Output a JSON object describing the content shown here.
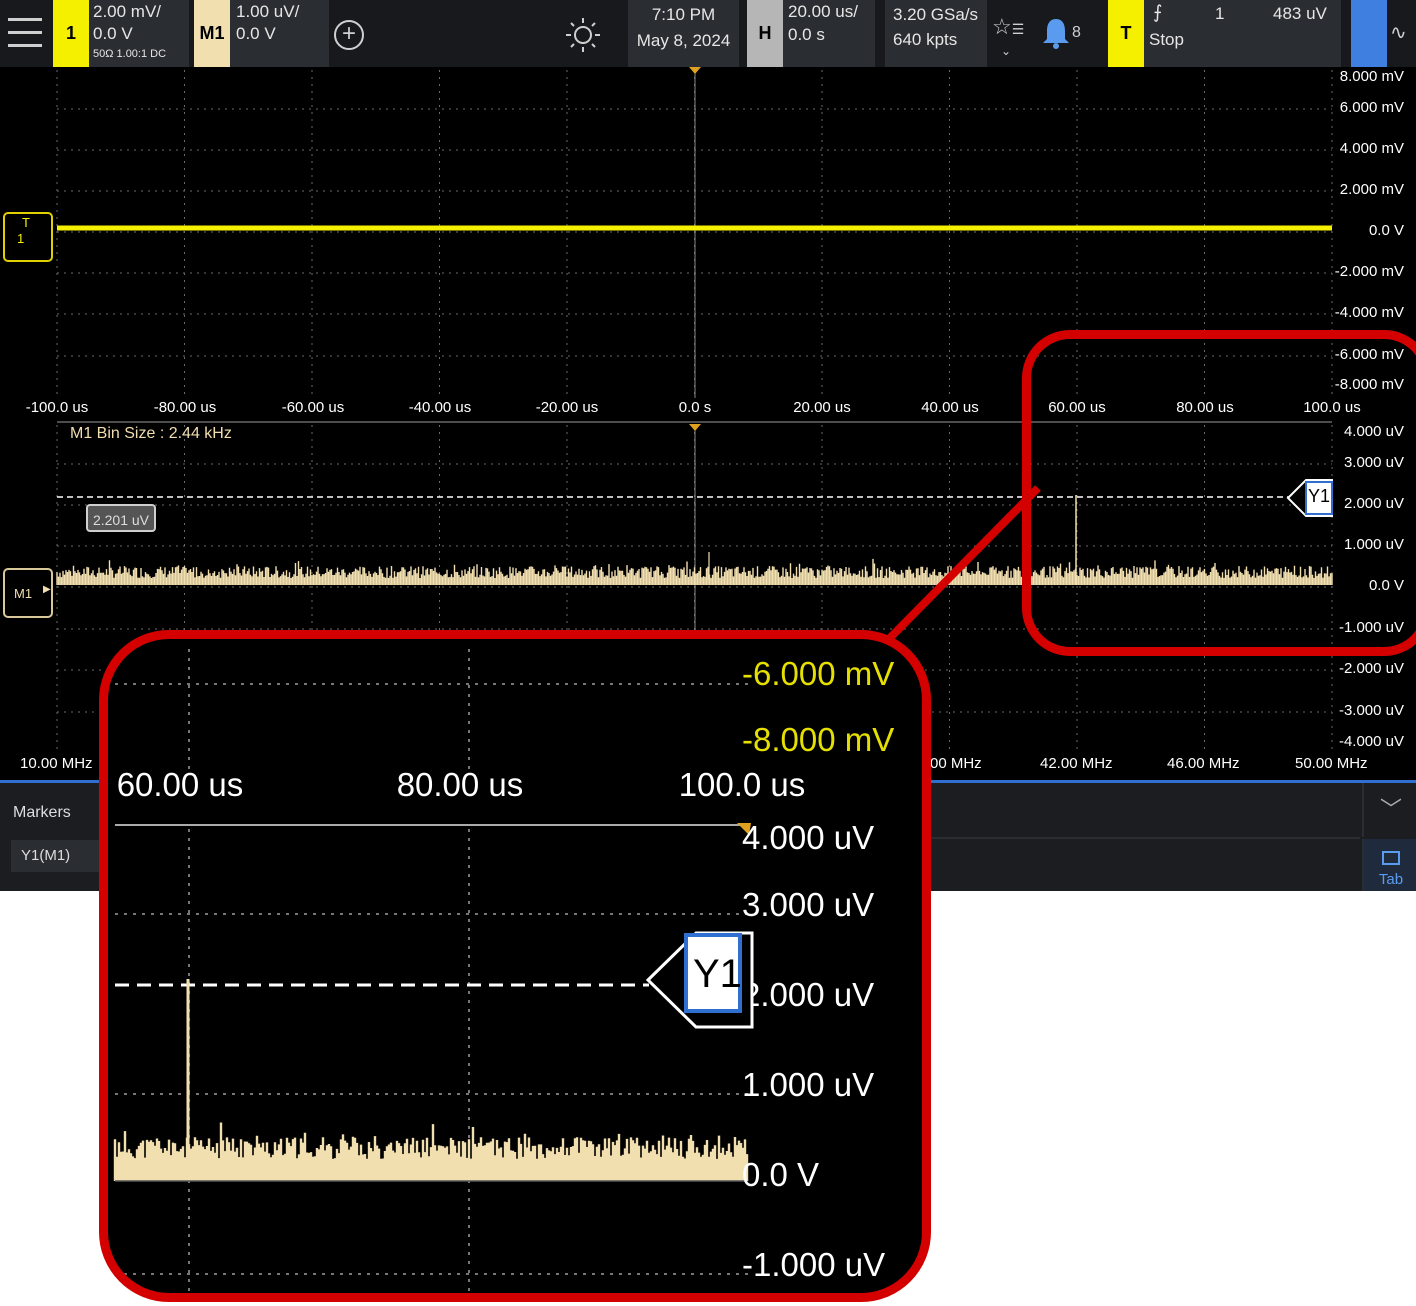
{
  "topbar": {
    "ch1": {
      "tag": "1",
      "scale": "2.00 mV/",
      "offset": "0.0 V",
      "details": "50Ω   1.00:1  DC"
    },
    "m1": {
      "tag": "M1",
      "scale": "1.00 uV/",
      "offset": "0.0 V"
    },
    "add_icon": "plus-circle-icon",
    "brightness_icon": "sun-icon",
    "time": "7:10 PM",
    "date": "May 8, 2024",
    "horizontal": {
      "tag": "H",
      "scale": "20.00 us/",
      "delay": "0.0 s"
    },
    "acq": {
      "rate": "3.20 GSa/s",
      "points": "640 kpts"
    },
    "notifications": "8",
    "trigger": {
      "tag": "T",
      "source": "1",
      "level": "483 uV",
      "status": "Stop"
    }
  },
  "upper": {
    "ylabels": [
      "8.000 mV",
      "6.000 mV",
      "4.000 mV",
      "2.000 mV",
      "0.0 V",
      "-2.000 mV",
      "-4.000 mV",
      "-6.000 mV",
      "-8.000 mV"
    ],
    "xlabels": [
      "-100.0 us",
      "-80.00 us",
      "-60.00 us",
      "-40.00 us",
      "-20.00 us",
      "0.0 s",
      "20.00 us",
      "40.00 us",
      "60.00 us",
      "80.00 us",
      "100.0 us"
    ],
    "marker_top": "T",
    "marker_ch": "1"
  },
  "lower": {
    "bin_size": "M1 Bin Size : 2.44 kHz",
    "cursor_value": "2.201 uV",
    "y1_label": "Y1",
    "m1_label": "M1",
    "ylabels": [
      "4.000 uV",
      "3.000 uV",
      "2.000 uV",
      "1.000 uV",
      "0.0 V",
      "-1.000 uV",
      "-2.000 uV",
      "-3.000 uV",
      "-4.000 uV"
    ],
    "xlabels_left": "10.00 MHz",
    "xlabels_right": [
      "00 MHz",
      "42.00 MHz",
      "46.00 MHz",
      "50.00 MHz"
    ]
  },
  "markers": {
    "title": "Markers",
    "item": "Y1(M1)",
    "tab_label": "Tab"
  },
  "zoom": {
    "ylabels_upper": [
      "-6.000 mV",
      "-8.000 mV"
    ],
    "xlabels": [
      "60.00 us",
      "80.00 us",
      "100.0 us"
    ],
    "ylabels_lower": [
      "4.000 uV",
      "3.000 uV",
      "2.000 uV",
      "1.000 uV",
      "0.0 V",
      "-1.000 uV"
    ],
    "y1_label": "Y1"
  },
  "colors": {
    "ch1": "#f4f000",
    "m1": "#f2dfb0",
    "highlight": "#d40000",
    "cursor_blue": "#2f6fd0"
  }
}
